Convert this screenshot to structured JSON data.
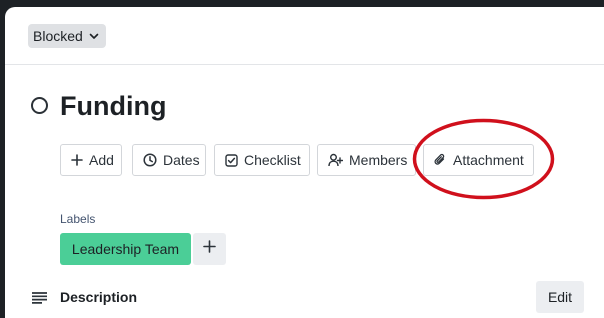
{
  "card": {
    "status": "Blocked",
    "title": "Funding"
  },
  "actions": {
    "add": "Add",
    "dates": "Dates",
    "checklist": "Checklist",
    "members": "Members",
    "attachment": "Attachment"
  },
  "labels": {
    "caption": "Labels",
    "items": [
      {
        "name": "Leadership Team",
        "color": "#4bce97"
      }
    ]
  },
  "description": {
    "title": "Description",
    "edit_label": "Edit"
  },
  "annotation": {
    "color": "#d0101c",
    "target": "attachment-button"
  }
}
